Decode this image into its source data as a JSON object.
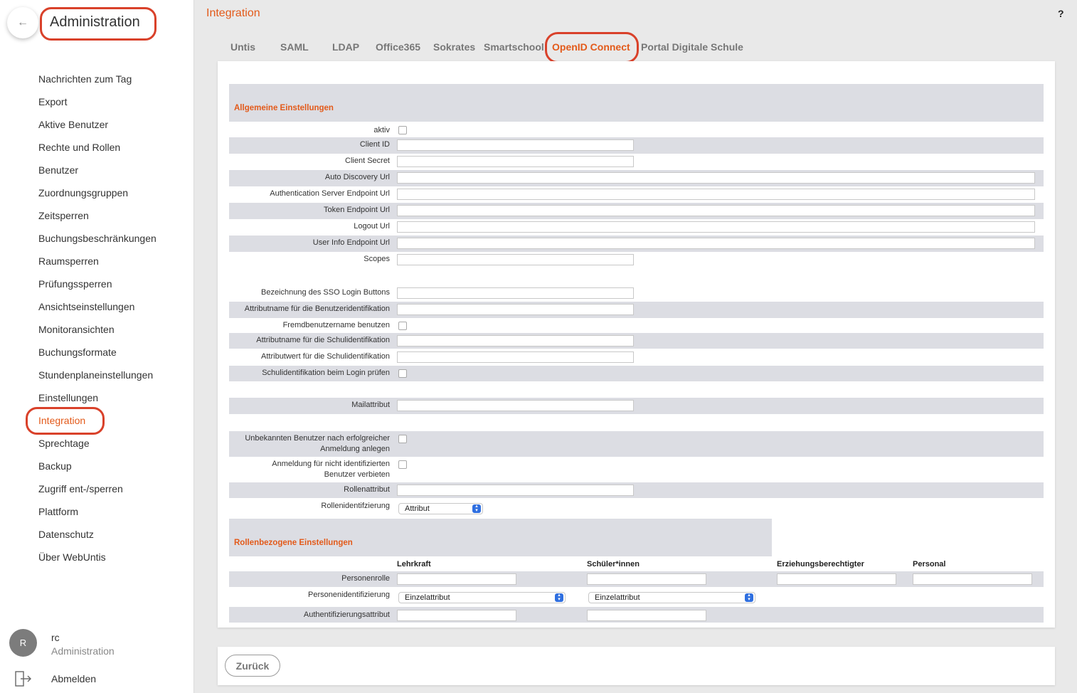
{
  "sidebar": {
    "title": "Administration",
    "back_icon": "arrow-left-icon",
    "items": [
      {
        "label": "Nachrichten zum Tag"
      },
      {
        "label": "Export"
      },
      {
        "label": "Aktive Benutzer"
      },
      {
        "label": "Rechte und Rollen"
      },
      {
        "label": "Benutzer"
      },
      {
        "label": "Zuordnungsgruppen"
      },
      {
        "label": "Zeitsperren"
      },
      {
        "label": "Buchungsbeschränkungen"
      },
      {
        "label": "Raumsperren"
      },
      {
        "label": "Prüfungssperren"
      },
      {
        "label": "Ansichtseinstellungen"
      },
      {
        "label": "Monitoransichten"
      },
      {
        "label": "Buchungsformate"
      },
      {
        "label": "Stundenplaneinstellungen"
      },
      {
        "label": "Einstellungen"
      },
      {
        "label": "Integration",
        "active": true
      },
      {
        "label": "Sprechtage"
      },
      {
        "label": "Backup"
      },
      {
        "label": "Zugriff ent-/sperren"
      },
      {
        "label": "Plattform"
      },
      {
        "label": "Datenschutz"
      },
      {
        "label": "Über WebUntis"
      }
    ],
    "user": {
      "initial": "R",
      "name": "rc",
      "role": "Administration"
    },
    "logout_label": "Abmelden"
  },
  "header": {
    "title": "Integration",
    "help": "?"
  },
  "tabs": [
    {
      "label": "Untis"
    },
    {
      "label": "SAML"
    },
    {
      "label": "LDAP"
    },
    {
      "label": "Office365"
    },
    {
      "label": "Sokrates"
    },
    {
      "label": "Smartschool"
    },
    {
      "label": "OpenID Connect",
      "active": true
    },
    {
      "label": "Portal Digitale Schule"
    }
  ],
  "form": {
    "general_title": "Allgemeine Einstellungen",
    "fields": {
      "aktiv": "aktiv",
      "client_id": "Client ID",
      "client_secret": "Client Secret",
      "auto_discovery": "Auto Discovery Url",
      "auth_endpoint": "Authentication Server Endpoint Url",
      "token_endpoint": "Token Endpoint Url",
      "logout": "Logout Url",
      "userinfo": "User Info Endpoint Url",
      "scopes": "Scopes",
      "sso_button": "Bezeichnung des SSO Login Buttons",
      "user_attr": "Attributname für die Benutzeridentifikation",
      "foreign_user": "Fremdbenutzername benutzen",
      "school_attr": "Attributname für die Schulidentifikation",
      "school_value": "Attributwert für die Schulidentifikation",
      "school_login": "Schulidentifikation beim Login prüfen",
      "mail": "Mailattribut",
      "create_unknown": "Unbekannten Benutzer nach erfolgreicher Anmeldung anlegen",
      "forbid_unidentified": "Anmeldung für nicht identifizierten Benutzer verbieten",
      "role_attr": "Rollenattribut",
      "role_ident": "Rollenidentifzierung"
    },
    "role_ident_value": "Attribut",
    "roles_title": "Rollenbezogene Einstellungen",
    "role_columns": [
      "Lehrkraft",
      "Schüler*innen",
      "Erziehungsberechtigter",
      "Personal"
    ],
    "role_rows": {
      "personenrolle": "Personenrolle",
      "personenidentifizierung": "Personenidentifizierung",
      "authentifizierungsattribut": "Authentifizierungsattribut"
    },
    "person_ident_values": [
      "Einzelattribut",
      "Einzelattribut"
    ]
  },
  "footer": {
    "back_label": "Zurück"
  },
  "colors": {
    "accent": "#e35a1a",
    "circle": "#d9412a",
    "band": "#dcdde3"
  }
}
